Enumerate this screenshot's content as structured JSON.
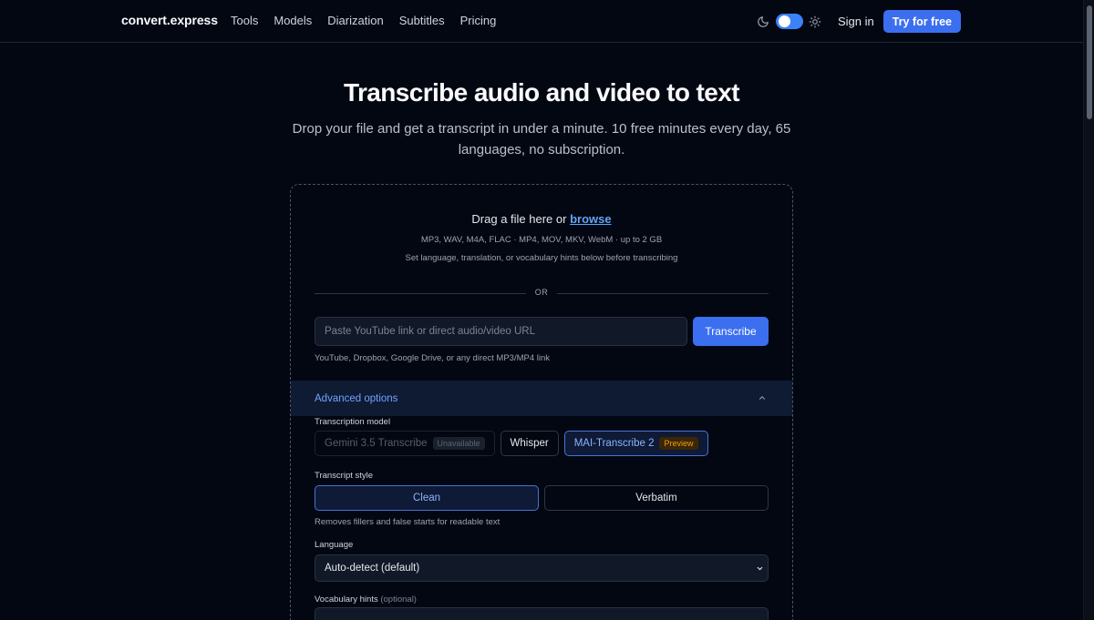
{
  "nav": {
    "brand": "convert.express",
    "links": [
      "Tools",
      "Models",
      "Diarization",
      "Subtitles",
      "Pricing"
    ],
    "sign_in": "Sign in",
    "cta": "Try for free",
    "theme_toggle": {
      "icons": [
        "moon-icon",
        "sun-icon"
      ],
      "state": "on"
    }
  },
  "hero": {
    "title": "Transcribe audio and video to text",
    "subtitle": "Drop your file and get a transcript in under a minute. 10 free minutes every day, 65 languages, no subscription."
  },
  "upload": {
    "drop_text": "Drag a file here or ",
    "browse": "browse",
    "formats": "MP3, WAV, M4A, FLAC · MP4, MOV, MKV, WebM · up to 2 GB",
    "hint": "Set language, translation, or vocabulary hints below before transcribing",
    "or": "OR",
    "url_placeholder": "Paste YouTube link or direct audio/video URL",
    "url_value": "",
    "transcribe": "Transcribe",
    "url_hint": "YouTube, Dropbox, Google Drive, or any direct MP3/MP4 link"
  },
  "advanced": {
    "title": "Advanced options",
    "model_label": "Transcription model",
    "models": [
      {
        "name": "Gemini 3.5 Transcribe",
        "badge": "Unavailable",
        "state": "disabled"
      },
      {
        "name": "Whisper",
        "badge": "",
        "state": "default"
      },
      {
        "name": "MAI-Transcribe 2",
        "badge": "Preview",
        "state": "selected"
      }
    ],
    "style_label": "Transcript style",
    "styles": [
      {
        "name": "Clean",
        "state": "selected"
      },
      {
        "name": "Verbatim",
        "state": "default"
      }
    ],
    "style_hint": "Removes fillers and false starts for readable text",
    "language_label": "Language",
    "language_value": "Auto-detect (default)",
    "vocab_label": "Vocabulary hints",
    "vocab_optional": "(optional)"
  },
  "colors": {
    "background": "#030712",
    "accent": "#3b6ff0",
    "link": "#60a5fa",
    "preview_badge": "#f59e0b"
  }
}
